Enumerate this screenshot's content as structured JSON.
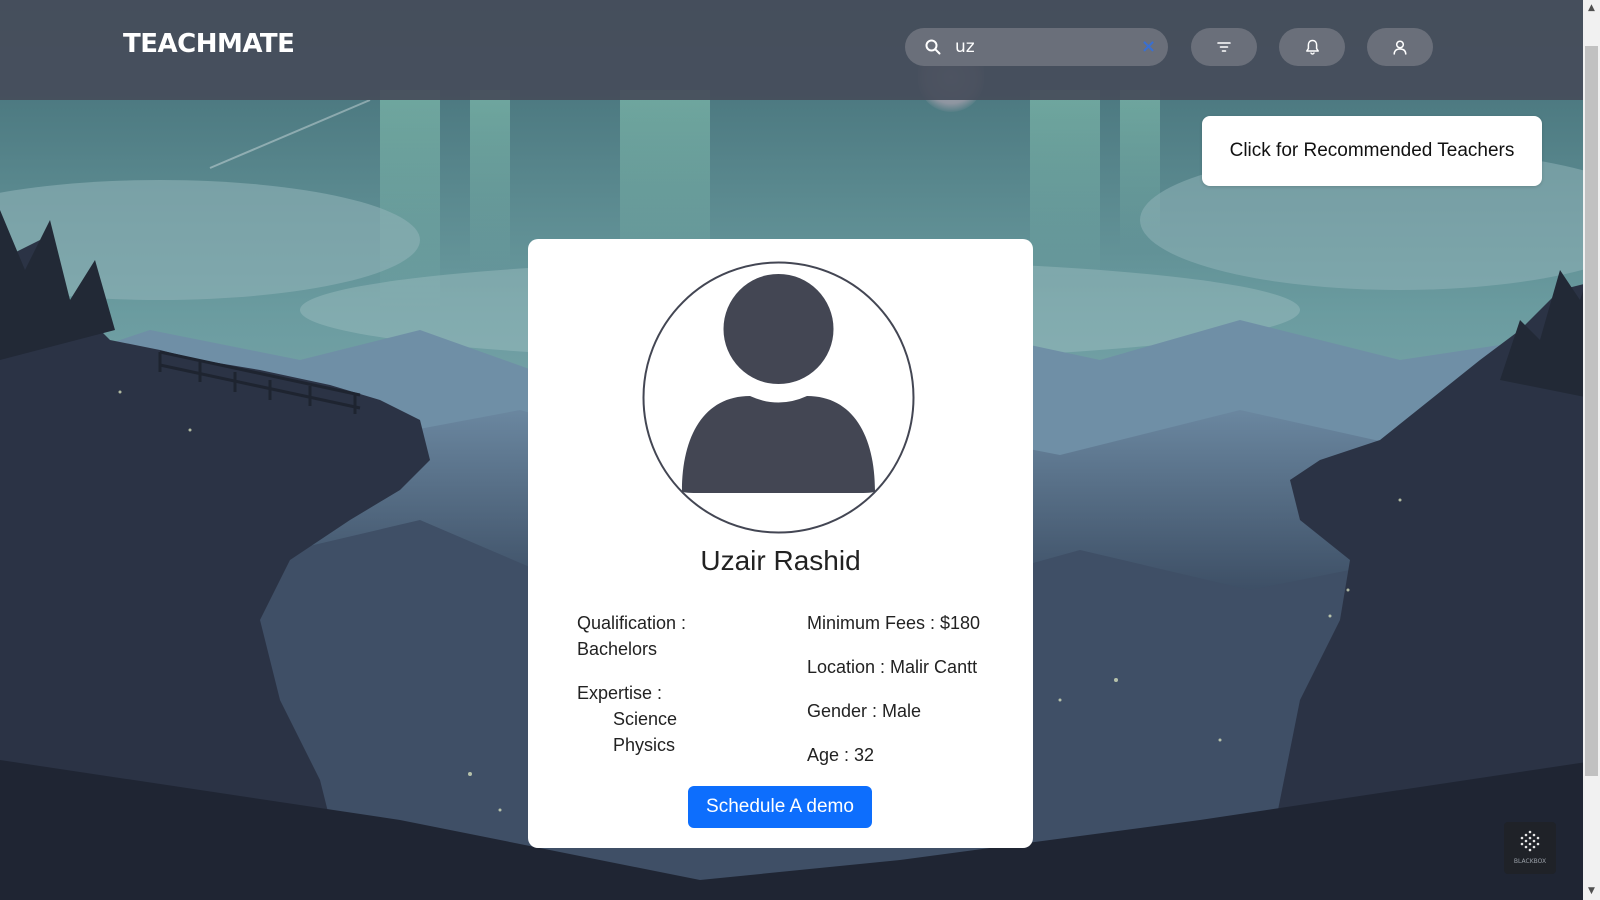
{
  "header": {
    "brand": "TEACHMATE",
    "search": {
      "value": "uz",
      "placeholder": "",
      "clear_glyph": "×"
    },
    "buttons": [
      {
        "name": "filter-button",
        "icon": "filter-icon"
      },
      {
        "name": "notifications-button",
        "icon": "bell-icon"
      },
      {
        "name": "profile-button",
        "icon": "user-icon"
      }
    ]
  },
  "recommend_button": "Click for Recommended Teachers",
  "profile": {
    "name": "Uzair Rashid",
    "qualification_label": "Qualification :",
    "qualification_value": "Bachelors",
    "expertise_label": "Expertise :",
    "expertise_items": [
      "Science",
      "Physics"
    ],
    "fees": "Minimum Fees : $180",
    "location": "Location : Malir Cantt",
    "gender": "Gender : Male",
    "age": "Age : 32",
    "schedule_button": "Schedule A demo",
    "avatar_icon": "user-avatar-icon"
  },
  "widget": {
    "label": "BLACKBOX",
    "icon": "blackbox-logo-icon"
  },
  "colors": {
    "header_bg": "#464c5a",
    "pill_bg": "#6a6f7a",
    "primary_button": "#0d6efd",
    "avatar_fill": "#434653",
    "card_bg": "#ffffff"
  }
}
